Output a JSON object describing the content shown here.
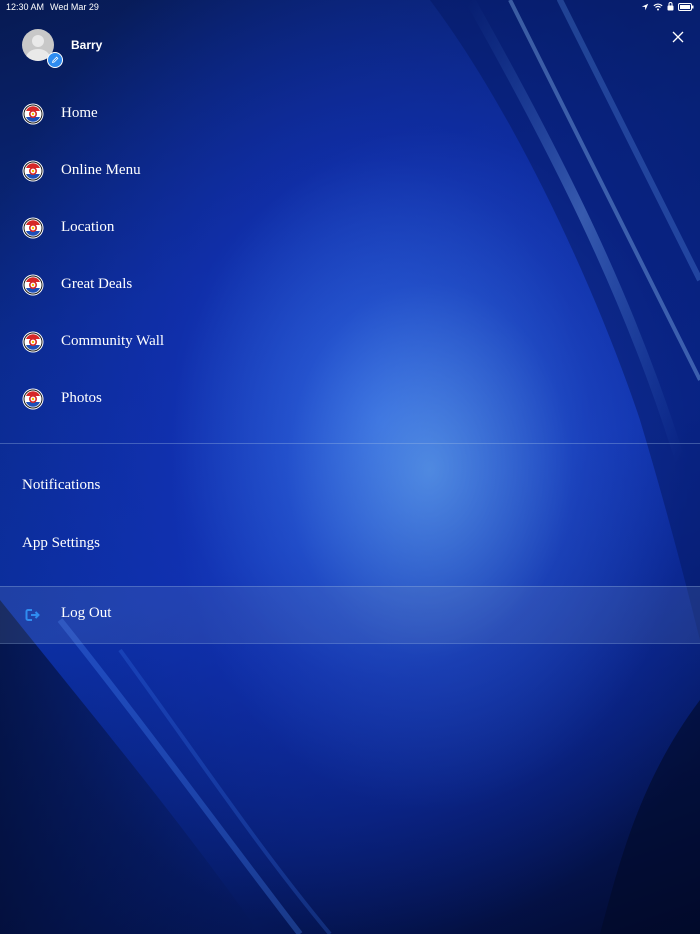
{
  "status_bar": {
    "time": "12:30 AM",
    "date": "Wed Mar 29"
  },
  "profile": {
    "name": "Barry"
  },
  "menu": {
    "items": [
      {
        "label": "Home",
        "icon": "restaurant-logo-icon"
      },
      {
        "label": "Online Menu",
        "icon": "restaurant-logo-icon"
      },
      {
        "label": "Location",
        "icon": "restaurant-logo-icon"
      },
      {
        "label": "Great Deals",
        "icon": "restaurant-logo-icon"
      },
      {
        "label": "Community Wall",
        "icon": "restaurant-logo-icon"
      },
      {
        "label": "Photos",
        "icon": "restaurant-logo-icon"
      }
    ]
  },
  "secondary": {
    "notifications": "Notifications",
    "app_settings": "App Settings",
    "logout": "Log Out"
  },
  "colors": {
    "accent": "#2f8cf0",
    "text": "#ffffff"
  }
}
